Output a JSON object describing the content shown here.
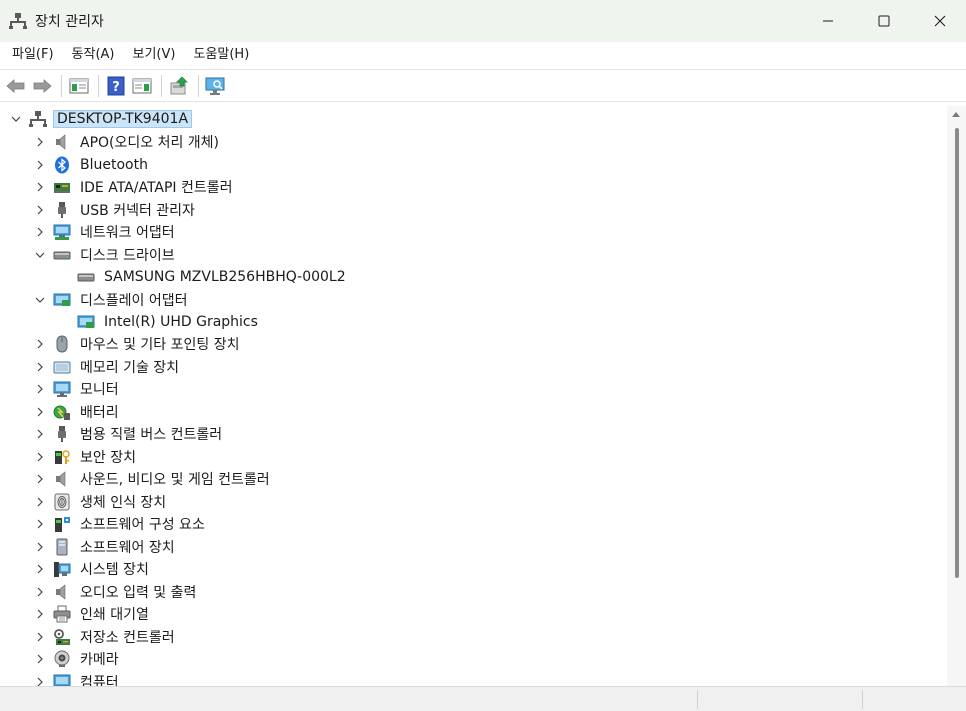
{
  "window": {
    "title": "장치 관리자"
  },
  "menu": [
    "파일(F)",
    "동작(A)",
    "보기(V)",
    "도움말(H)"
  ],
  "toolbar": {
    "buttons": [
      "back-icon",
      "forward-icon",
      "properties-view-icon",
      "help-icon",
      "details-view-icon",
      "update-driver-icon",
      "scan-hardware-icon"
    ]
  },
  "tree": {
    "root": "DESKTOP-TK9401A",
    "items": [
      {
        "label": "APO(오디오 처리 개체)",
        "icon": "speaker-icon",
        "expanded": false
      },
      {
        "label": "Bluetooth",
        "icon": "bluetooth-icon",
        "expanded": false
      },
      {
        "label": "IDE ATA/ATAPI 컨트롤러",
        "icon": "ide-controller-icon",
        "expanded": false
      },
      {
        "label": "USB 커넥터 관리자",
        "icon": "usb-icon",
        "expanded": false
      },
      {
        "label": "네트워크 어댑터",
        "icon": "network-icon",
        "expanded": false
      },
      {
        "label": "디스크 드라이브",
        "icon": "disk-icon",
        "expanded": true,
        "children": [
          "SAMSUNG MZVLB256HBHQ-000L2"
        ]
      },
      {
        "label": "디스플레이 어댑터",
        "icon": "display-adapter-icon",
        "expanded": true,
        "children": [
          "Intel(R) UHD Graphics"
        ]
      },
      {
        "label": "마우스 및 기타 포인팅 장치",
        "icon": "mouse-icon",
        "expanded": false
      },
      {
        "label": "메모리 기술 장치",
        "icon": "memory-icon",
        "expanded": false
      },
      {
        "label": "모니터",
        "icon": "monitor-icon",
        "expanded": false
      },
      {
        "label": "배터리",
        "icon": "battery-icon",
        "expanded": false
      },
      {
        "label": "범용 직렬 버스 컨트롤러",
        "icon": "usb-controller-icon",
        "expanded": false
      },
      {
        "label": "보안 장치",
        "icon": "security-icon",
        "expanded": false
      },
      {
        "label": "사운드, 비디오 및 게임 컨트롤러",
        "icon": "sound-icon",
        "expanded": false
      },
      {
        "label": "생체 인식 장치",
        "icon": "fingerprint-icon",
        "expanded": false
      },
      {
        "label": "소프트웨어 구성 요소",
        "icon": "software-component-icon",
        "expanded": false
      },
      {
        "label": "소프트웨어 장치",
        "icon": "software-device-icon",
        "expanded": false
      },
      {
        "label": "시스템 장치",
        "icon": "system-icon",
        "expanded": false
      },
      {
        "label": "오디오 입력 및 출력",
        "icon": "audio-io-icon",
        "expanded": false
      },
      {
        "label": "인쇄 대기열",
        "icon": "printer-icon",
        "expanded": false
      },
      {
        "label": "저장소 컨트롤러",
        "icon": "storage-controller-icon",
        "expanded": false
      },
      {
        "label": "카메라",
        "icon": "camera-icon",
        "expanded": false
      },
      {
        "label": "컴퓨터",
        "icon": "computer-icon",
        "expanded": false
      }
    ]
  }
}
